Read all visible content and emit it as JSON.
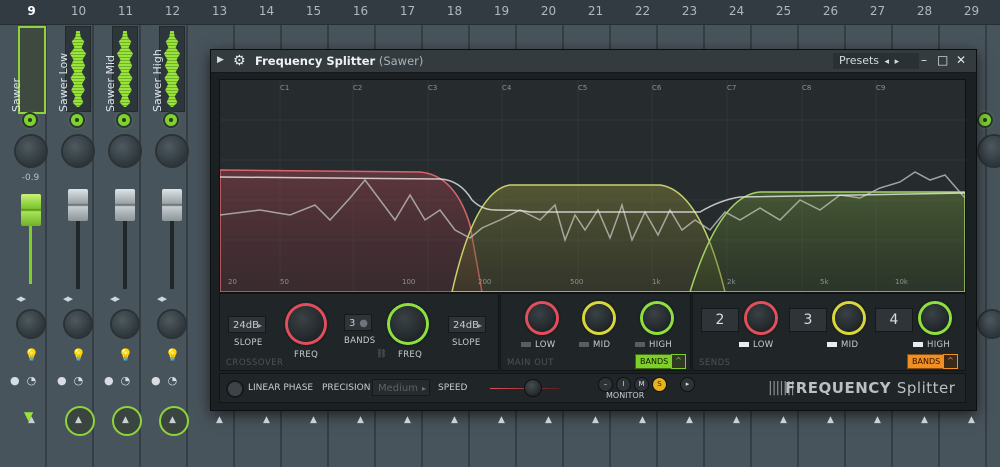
{
  "mixer": {
    "track_numbers": [
      "9",
      "10",
      "11",
      "12",
      "13",
      "14",
      "15",
      "16",
      "17",
      "18",
      "19",
      "20",
      "21",
      "22",
      "23",
      "24",
      "25",
      "26",
      "27",
      "28",
      "29"
    ],
    "strips": [
      {
        "name": "Sawer",
        "selected": true,
        "pan_value": "-0.9"
      },
      {
        "name": "Sawer Low",
        "selected": false
      },
      {
        "name": "Sawer Mid",
        "selected": false
      },
      {
        "name": "Sawer High",
        "selected": false
      }
    ],
    "stereo_glyph": "◂▸",
    "bulb_glyph": "💡",
    "clock_glyph": "◔",
    "tri_glyph": "▲",
    "route_glyph": "▼"
  },
  "plugin": {
    "title": "Frequency Splitter",
    "subtitle": "(Sawer)",
    "presets_label": "Presets",
    "presets_prev": "◂",
    "presets_next": "▸",
    "win_min": "–",
    "win_max": "□",
    "win_close": "✕",
    "notes": [
      "C1",
      "C2",
      "C3",
      "C4",
      "C5",
      "C6",
      "C7",
      "C8",
      "C9"
    ],
    "freq_ticks": [
      "20",
      "50",
      "100",
      "200",
      "500",
      "1k",
      "2k",
      "5k",
      "10k"
    ],
    "crossover": {
      "section_label": "CROSSOVER",
      "slope_left": "24dB",
      "slope_right": "24dB",
      "slope_label": "SLOPE",
      "freq_label": "FREQ",
      "bands_value": "3",
      "bands_label": "BANDS",
      "link_glyph": "⛓"
    },
    "main_out": {
      "section_label": "MAIN OUT",
      "low": "LOW",
      "mid": "MID",
      "high": "HIGH",
      "bands_button": "BANDS",
      "up": "^"
    },
    "sends": {
      "section_label": "SENDS",
      "low_num": "2",
      "mid_num": "3",
      "high_num": "4",
      "low": "LOW",
      "mid": "MID",
      "high": "HIGH",
      "bands_button": "BANDS",
      "up": "^"
    },
    "bottom": {
      "linear_phase": "LINEAR PHASE",
      "precision_label": "PRECISION",
      "precision_value": "Medium",
      "speed_label": "SPEED",
      "monitor_label": "MONITOR",
      "mon_buttons": [
        "–",
        "I",
        "M",
        "S",
        "▸"
      ],
      "logo_bold": "FREQUENCY",
      "logo_light": "Splitter",
      "logo_bars": "|||||||"
    },
    "colors": {
      "low": "#e34e5c",
      "mid": "#d9d83a",
      "high": "#8ee03e",
      "accent_green": "#7fcf2a",
      "accent_orange": "#f28f22"
    }
  }
}
